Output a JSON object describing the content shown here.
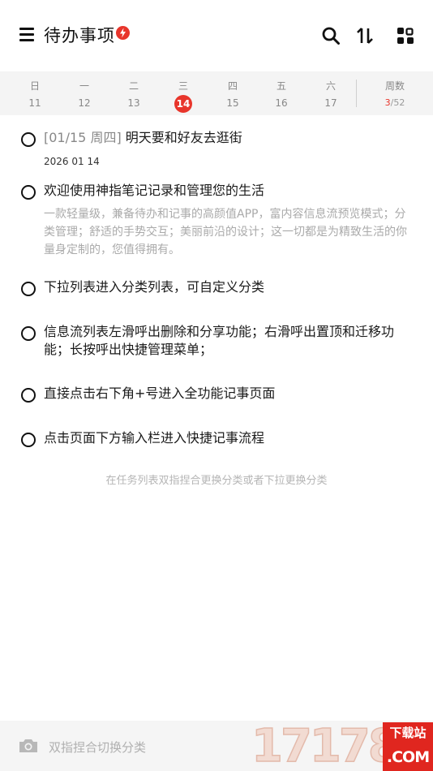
{
  "header": {
    "title": "待办事项",
    "badge_icon": "lightning-icon",
    "accent": "#e8352b",
    "icons": [
      "menu-icon",
      "search-icon",
      "sort-icon",
      "grid-icon"
    ]
  },
  "week": {
    "days": [
      {
        "name": "日",
        "num": "11"
      },
      {
        "name": "一",
        "num": "12"
      },
      {
        "name": "二",
        "num": "13"
      },
      {
        "name": "三",
        "num": "14"
      },
      {
        "name": "四",
        "num": "15"
      },
      {
        "name": "五",
        "num": "16"
      },
      {
        "name": "六",
        "num": "17"
      }
    ],
    "today_num": "14",
    "weeknum_label": "周数",
    "weeknum_current": "3",
    "weeknum_total": "/52"
  },
  "tasks": [
    {
      "prefix": "[01/15 周四]",
      "title": "明天要和好友去逛街",
      "date": "2026 01 14"
    },
    {
      "title": "欢迎使用神指笔记记录和管理您的生活",
      "sub": "一款轻量级，兼备待办和记事的高颜值APP，富内容信息流预览模式；分类管理；舒适的手势交互；美丽前沿的设计；这一切都是为精致生活的你量身定制的，您值得拥有。"
    },
    {
      "title": "下拉列表进入分类列表，可自定义分类"
    },
    {
      "title": "信息流列表左滑呼出删除和分享功能；右滑呼出置顶和迁移功能；长按呼出快捷管理菜单；"
    },
    {
      "title": "直接点击右下角+号进入全功能记事页面"
    },
    {
      "title": "点击页面下方输入栏进入快捷记事流程"
    }
  ],
  "hint": "在任务列表双指捏合更换分类或者下拉更换分类",
  "bottom": {
    "placeholder": "双指捏合切换分类",
    "camera_icon": "camera-icon"
  },
  "watermark": {
    "digits": "17178",
    "top": "下载站",
    "bottom": ".COM"
  }
}
